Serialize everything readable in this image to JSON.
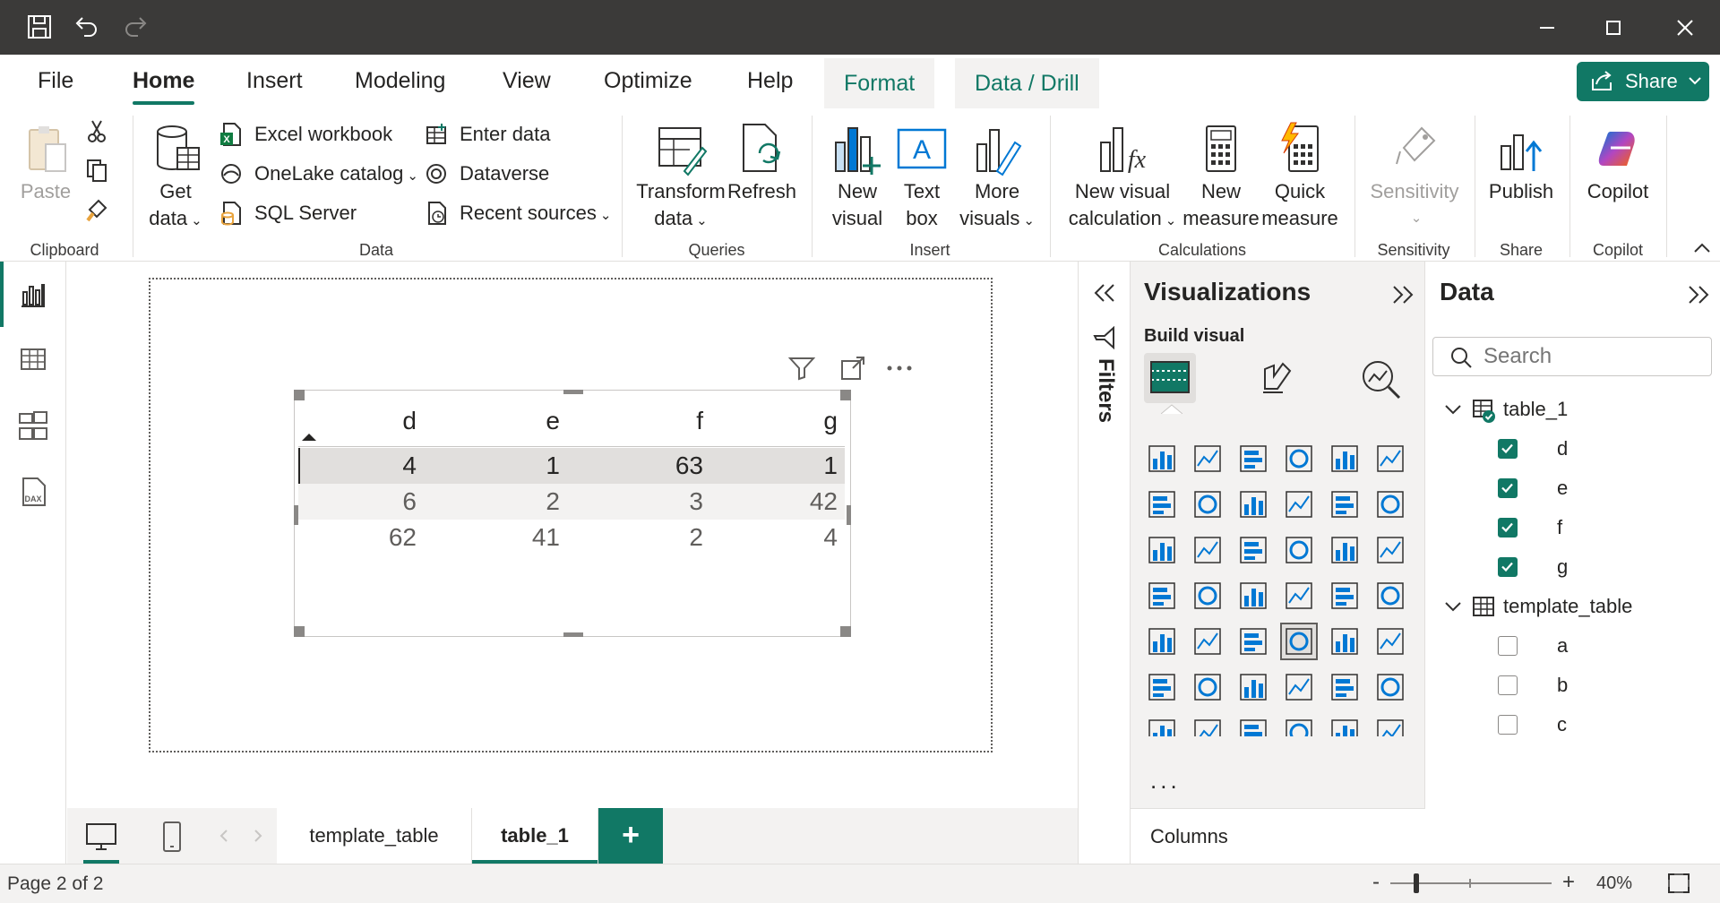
{
  "menu": {
    "tabs": [
      "File",
      "Home",
      "Insert",
      "Modeling",
      "View",
      "Optimize",
      "Help"
    ],
    "context_tabs": [
      "Format",
      "Data / Drill"
    ],
    "share": "Share"
  },
  "ribbon": {
    "clipboard": {
      "paste": "Paste",
      "label": "Clipboard"
    },
    "data": {
      "get_data_1": "Get",
      "get_data_2": "data",
      "excel": "Excel workbook",
      "onelake": "OneLake catalog",
      "sql": "SQL Server",
      "enter": "Enter data",
      "dataverse": "Dataverse",
      "recent": "Recent sources",
      "label": "Data"
    },
    "queries": {
      "transform_1": "Transform",
      "transform_2": "data",
      "refresh": "Refresh",
      "label": "Queries"
    },
    "insert": {
      "new_visual_1": "New",
      "new_visual_2": "visual",
      "text_box_1": "Text",
      "text_box_2": "box",
      "more_visuals_1": "More",
      "more_visuals_2": "visuals",
      "label": "Insert"
    },
    "calculations": {
      "new_visual_calc_1": "New visual",
      "new_visual_calc_2": "calculation",
      "new_measure_1": "New",
      "new_measure_2": "measure",
      "quick_measure_1": "Quick",
      "quick_measure_2": "measure",
      "label": "Calculations"
    },
    "sensitivity": {
      "btn": "Sensitivity",
      "label": "Sensitivity"
    },
    "share": {
      "publish": "Publish",
      "label": "Share"
    },
    "copilot": {
      "btn": "Copilot",
      "label": "Copilot"
    }
  },
  "table_visual": {
    "headers": [
      "d",
      "e",
      "f",
      "g"
    ],
    "rows": [
      [
        "4",
        "1",
        "63",
        "1"
      ],
      [
        "6",
        "2",
        "3",
        "42"
      ],
      [
        "62",
        "41",
        "2",
        "4"
      ]
    ]
  },
  "pages": {
    "tabs": [
      "template_table",
      "table_1"
    ],
    "active": "table_1",
    "add": "+"
  },
  "filters": {
    "label": "Filters"
  },
  "visualizations": {
    "title": "Visualizations",
    "build_visual": "Build visual",
    "more": "...",
    "columns_label": "Columns"
  },
  "data_pane": {
    "title": "Data",
    "search_placeholder": "Search",
    "tables": [
      {
        "name": "table_1",
        "fields": [
          {
            "name": "d",
            "checked": true
          },
          {
            "name": "e",
            "checked": true
          },
          {
            "name": "f",
            "checked": true
          },
          {
            "name": "g",
            "checked": true
          }
        ]
      },
      {
        "name": "template_table",
        "fields": [
          {
            "name": "a",
            "checked": false
          },
          {
            "name": "b",
            "checked": false
          },
          {
            "name": "c",
            "checked": false
          }
        ]
      }
    ]
  },
  "status": {
    "page": "Page 2 of 2",
    "zoom": "40%",
    "zoom_minus": "-",
    "zoom_plus": "+"
  },
  "colors": {
    "accent": "#117865",
    "titlebar": "#3b3a39"
  }
}
